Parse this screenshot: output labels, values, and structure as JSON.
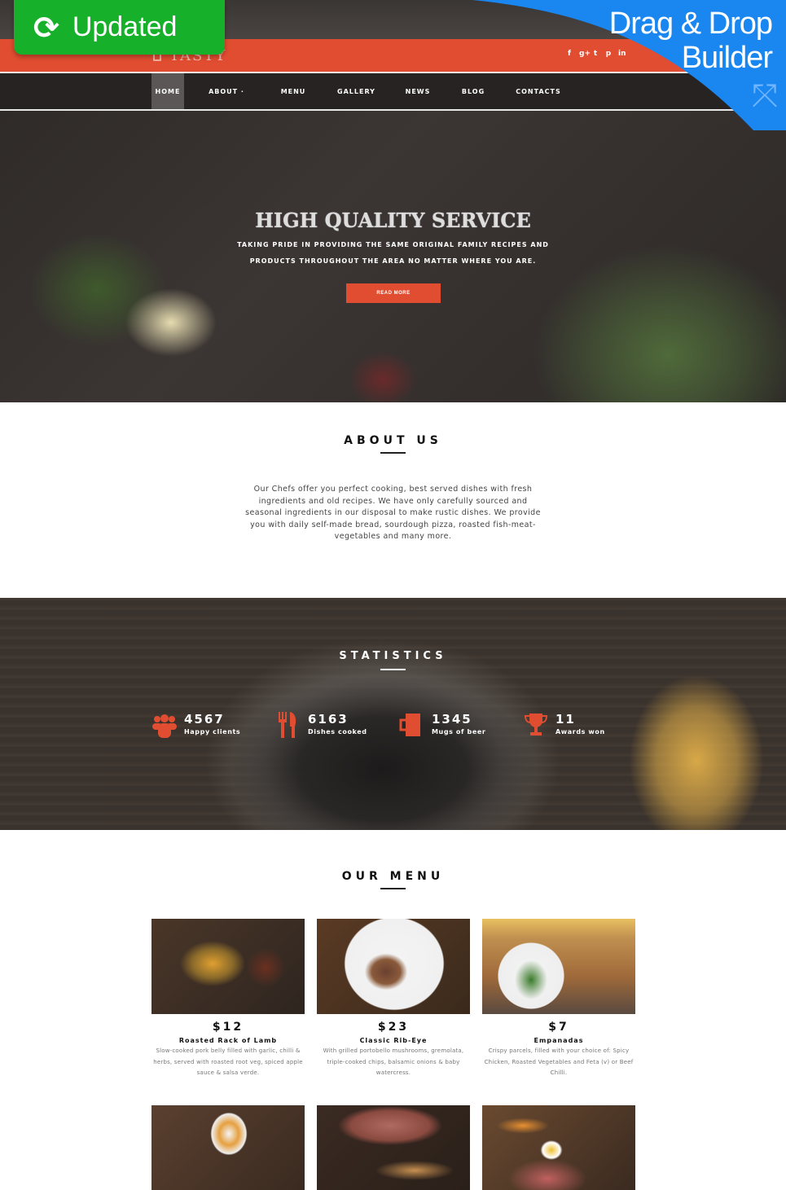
{
  "badges": {
    "updated": {
      "icon": "refresh-icon",
      "label": "Updated"
    },
    "builder": {
      "line1": "Drag & Drop",
      "line2": "Builder",
      "icon": "move-arrows-icon"
    }
  },
  "header": {
    "logo_text": "TASTY",
    "social": [
      {
        "name": "facebook-icon",
        "glyph": "f"
      },
      {
        "name": "google-plus-icon",
        "glyph": "g+"
      },
      {
        "name": "twitter-icon",
        "glyph": "t"
      },
      {
        "name": "pinterest-icon",
        "glyph": "p"
      },
      {
        "name": "linkedin-icon",
        "glyph": "in"
      }
    ],
    "nav": [
      {
        "label": "HOME",
        "active": true
      },
      {
        "label": "ABOUT ·",
        "active": false
      },
      {
        "label": "MENU",
        "active": false
      },
      {
        "label": "GALLERY",
        "active": false
      },
      {
        "label": "NEWS",
        "active": false
      },
      {
        "label": "BLOG",
        "active": false
      },
      {
        "label": "CONTACTS",
        "active": false
      }
    ]
  },
  "hero": {
    "title": "HIGH QUALITY SERVICE",
    "subtitle_line1": "TAKING PRIDE IN PROVIDING THE SAME ORIGINAL FAMILY RECIPES AND",
    "subtitle_line2": "PRODUCTS THROUGHOUT THE AREA NO MATTER WHERE YOU ARE.",
    "button": "READ MORE"
  },
  "about": {
    "title": "ABOUT US",
    "text": "Our Chefs offer you perfect cooking, best served dishes with fresh ingredients and old recipes. We have only carefully sourced and seasonal ingredients in our disposal to make rustic dishes. We provide you with daily self-made bread, sourdough pizza, roasted fish-meat-vegetables and many more."
  },
  "statistics": {
    "title": "STATISTICS",
    "items": [
      {
        "icon": "users-icon",
        "glyph": "👥",
        "value": "4567",
        "label": "Happy clients"
      },
      {
        "icon": "fork-knife-icon",
        "glyph": "🍴",
        "value": "6163",
        "label": "Dishes cooked"
      },
      {
        "icon": "beer-mug-icon",
        "glyph": "🍺",
        "value": "1345",
        "label": "Mugs of beer"
      },
      {
        "icon": "trophy-icon",
        "glyph": "🏆",
        "value": "11",
        "label": "Awards won"
      }
    ]
  },
  "menu": {
    "title": "OUR MENU",
    "dishes": [
      {
        "price": "$12",
        "name": "Roasted Rack of Lamb",
        "description": "Slow-cooked pork belly filled with garlic, chilli & herbs, served with roasted root veg, spiced apple sauce & salsa verde."
      },
      {
        "price": "$23",
        "name": "Classic Rib-Eye",
        "description": "With grilled portobello mushrooms, gremolata, triple-cooked chips, balsamic onions & baby watercress."
      },
      {
        "price": "$7",
        "name": "Empanadas",
        "description": "Crispy parcels, filled with your choice of: Spicy Chicken, Roasted Vegetables and Feta (v) or Beef Chilli."
      }
    ]
  },
  "colors": {
    "accent": "#e14d31",
    "updated_badge": "#16b02a",
    "builder_badge": "#1a86f0"
  }
}
